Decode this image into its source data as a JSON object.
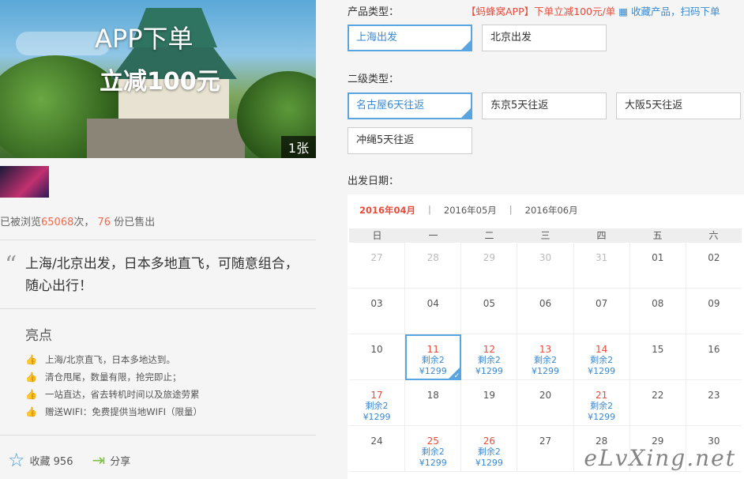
{
  "hero": {
    "promo_line1": "APP下单",
    "promo_line2": "立减100元",
    "photo_count": "1张"
  },
  "stats": {
    "prefix": "已被浏览",
    "views": "65068",
    "mid": "次，",
    "sold": "76",
    "suffix": "份已售出"
  },
  "quote": {
    "mark": "“",
    "text": "上海/北京出发，日本多地直飞，可随意组合，随心出行！"
  },
  "highlights": {
    "title": "亮点",
    "items": [
      "上海/北京直飞，日本多地达到。",
      "清仓甩尾，数量有限，抢完即止；",
      "一站直达，省去转机时间以及旅途劳累",
      "赠送WIFI：免费提供当地WIFI（限量）"
    ]
  },
  "actions": {
    "favorite_label": "收藏 956",
    "share_label": "分享"
  },
  "product": {
    "type_label": "产品类型：",
    "promo_red": "【蚂蜂窝APP】下单立减100元/单",
    "promo_blue": "收藏产品，扫码下单",
    "types": [
      "上海出发",
      "北京出发"
    ],
    "subtype_label": "二级类型：",
    "subtypes": [
      "名古屋6天往返",
      "东京5天往返",
      "大阪5天往返",
      "冲绳5天往返"
    ],
    "date_label": "出发日期："
  },
  "calendar": {
    "months": [
      "2016年04月",
      "2016年05月",
      "2016年06月"
    ],
    "weekdays": [
      "日",
      "一",
      "二",
      "三",
      "四",
      "五",
      "六"
    ],
    "remain_text": "剩余2",
    "price_text": "¥1299"
  },
  "watermark": "eLvXing.net",
  "colors": {
    "accent_blue": "#5aa5e0",
    "price_red": "#e84b3a"
  }
}
